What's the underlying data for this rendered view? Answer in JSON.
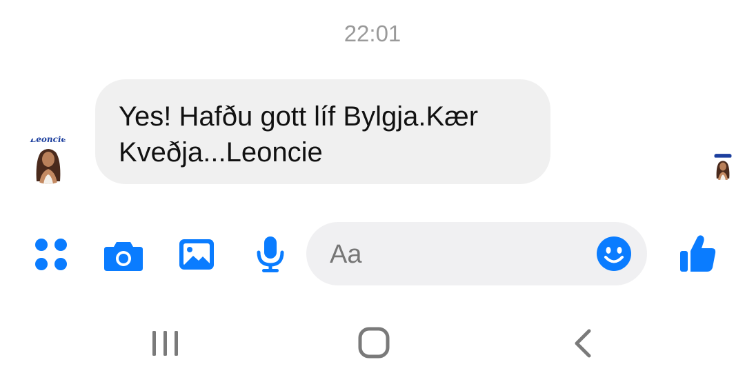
{
  "thread": {
    "timestamp": "22:01",
    "message": {
      "text": "Yes! Hafðu gott líf Bylgja.Kær\nKveðja...Leoncie",
      "sender_avatar_caption": "Leoncie"
    }
  },
  "composer": {
    "input_placeholder": "Aa",
    "input_value": "",
    "icons": [
      "apps-icon",
      "camera-icon",
      "gallery-icon",
      "microphone-icon",
      "emoji-icon",
      "thumbs-up-icon"
    ]
  },
  "nav_bar": {
    "icons": [
      "recent-apps-icon",
      "home-icon",
      "back-icon"
    ]
  },
  "colors": {
    "accent": "#0a7cff",
    "bubble": "#f0f0f0",
    "timestamp": "#9a9a9a",
    "nav": "#7a7a7a"
  }
}
